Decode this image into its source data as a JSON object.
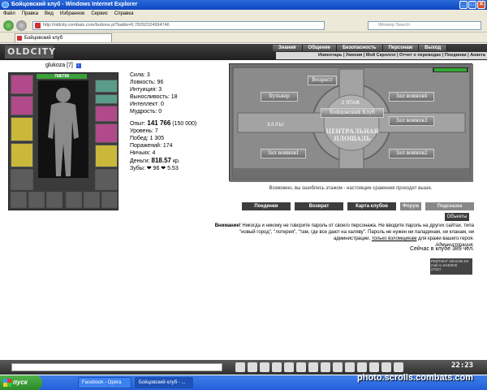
{
  "window": {
    "title": "Бойцовский клуб - Windows Internet Explorer",
    "min": "_",
    "max": "□",
    "close": "✕"
  },
  "menu": [
    "Файл",
    "Правка",
    "Вид",
    "Избранное",
    "Сервис",
    "Справка"
  ],
  "address": {
    "url": "http://oldcity.combats.com/buttons.pl?battle=0.78292324994746"
  },
  "search": {
    "placeholder": "Winamp Search"
  },
  "tab": {
    "label": "Бойцовский клуб"
  },
  "game": {
    "logo": "OLDCITY",
    "topnav": [
      "Знания",
      "Общение",
      "Безопасность",
      "Персонаж",
      "Выход"
    ],
    "subnav": "Инвентарь | Умения | Мой Скроллл | Отчет о переводах | Поединки | Анкета",
    "character": {
      "name": "glukoza",
      "level": "[7]",
      "info_badge": "i",
      "hp": "768/768",
      "stats": [
        {
          "label": "Сила: 3"
        },
        {
          "label": "Ловкость: 96"
        },
        {
          "label": "Интуиция: 3"
        },
        {
          "label": "Выносливость: 18"
        },
        {
          "label": "Интеллект: 0"
        },
        {
          "label": "Мудрость: 0"
        }
      ],
      "exp_label": "Опыт:",
      "exp_value": "141 766",
      "exp_next": "(150 000)",
      "level_line": "Уровень: 7",
      "wins": "Побед: 1 305",
      "losses": "Поражений: 174",
      "draws": "Ничьих: 4",
      "money_label": "Деньги:",
      "money_value": "818.57",
      "money_unit": "кр.",
      "teeth": "Зубы: ❤ 96 ❤ 5.53"
    },
    "map": {
      "floor_title": "2 ЭТАЖ",
      "club_btn": "Бойцовский Клуб",
      "bulvar": "Бульвар",
      "room4": "Зал воинов4",
      "vozrast": "Возраст",
      "room3": "Зал воинов3",
      "zaly": "ЗАЛЫ",
      "square": "ЦЕНТРАЛЬНАЯ ПЛОЩАДЬ",
      "room1": "Зал воинов1",
      "room2": "Зал воинов2"
    },
    "map_error": "Возможно, вы ошиблись этажом - настоящие сражения проходят выше.",
    "actions": [
      "Поединки",
      "Возврат",
      "Карта клубов",
      "Форум",
      "Подсказка"
    ],
    "objects_btn": "Объекты",
    "warning_bold": "Внимание!",
    "warning_text": "Никогда и никому не говорите пароль от своего персонажа. Не вводите пароль на других сайтах, типа \"новый город\", \"лотерея\", \"там, где все дают на халяву\". Пароль не нужен ни паладинам, ни кланам, ни администрации,",
    "warning_link": "только взломщикам",
    "warning_tail": "для кражи вашего героя.",
    "warning_sign": "Администрация.",
    "online": "Сейчас в клубе 389 чел.",
    "counter_l1": "РЕЙТИНГ 2904196 ЕК",
    "counter_l2": "mail.ru 9440630",
    "counter_l3": "27327",
    "clock": "22:23"
  },
  "taskbar": {
    "start": "пуск",
    "tasks": [
      "Facebook - Opera",
      "Бойцовский клуб - ..."
    ]
  },
  "watermark": "photo.scrolls.combats.com"
}
